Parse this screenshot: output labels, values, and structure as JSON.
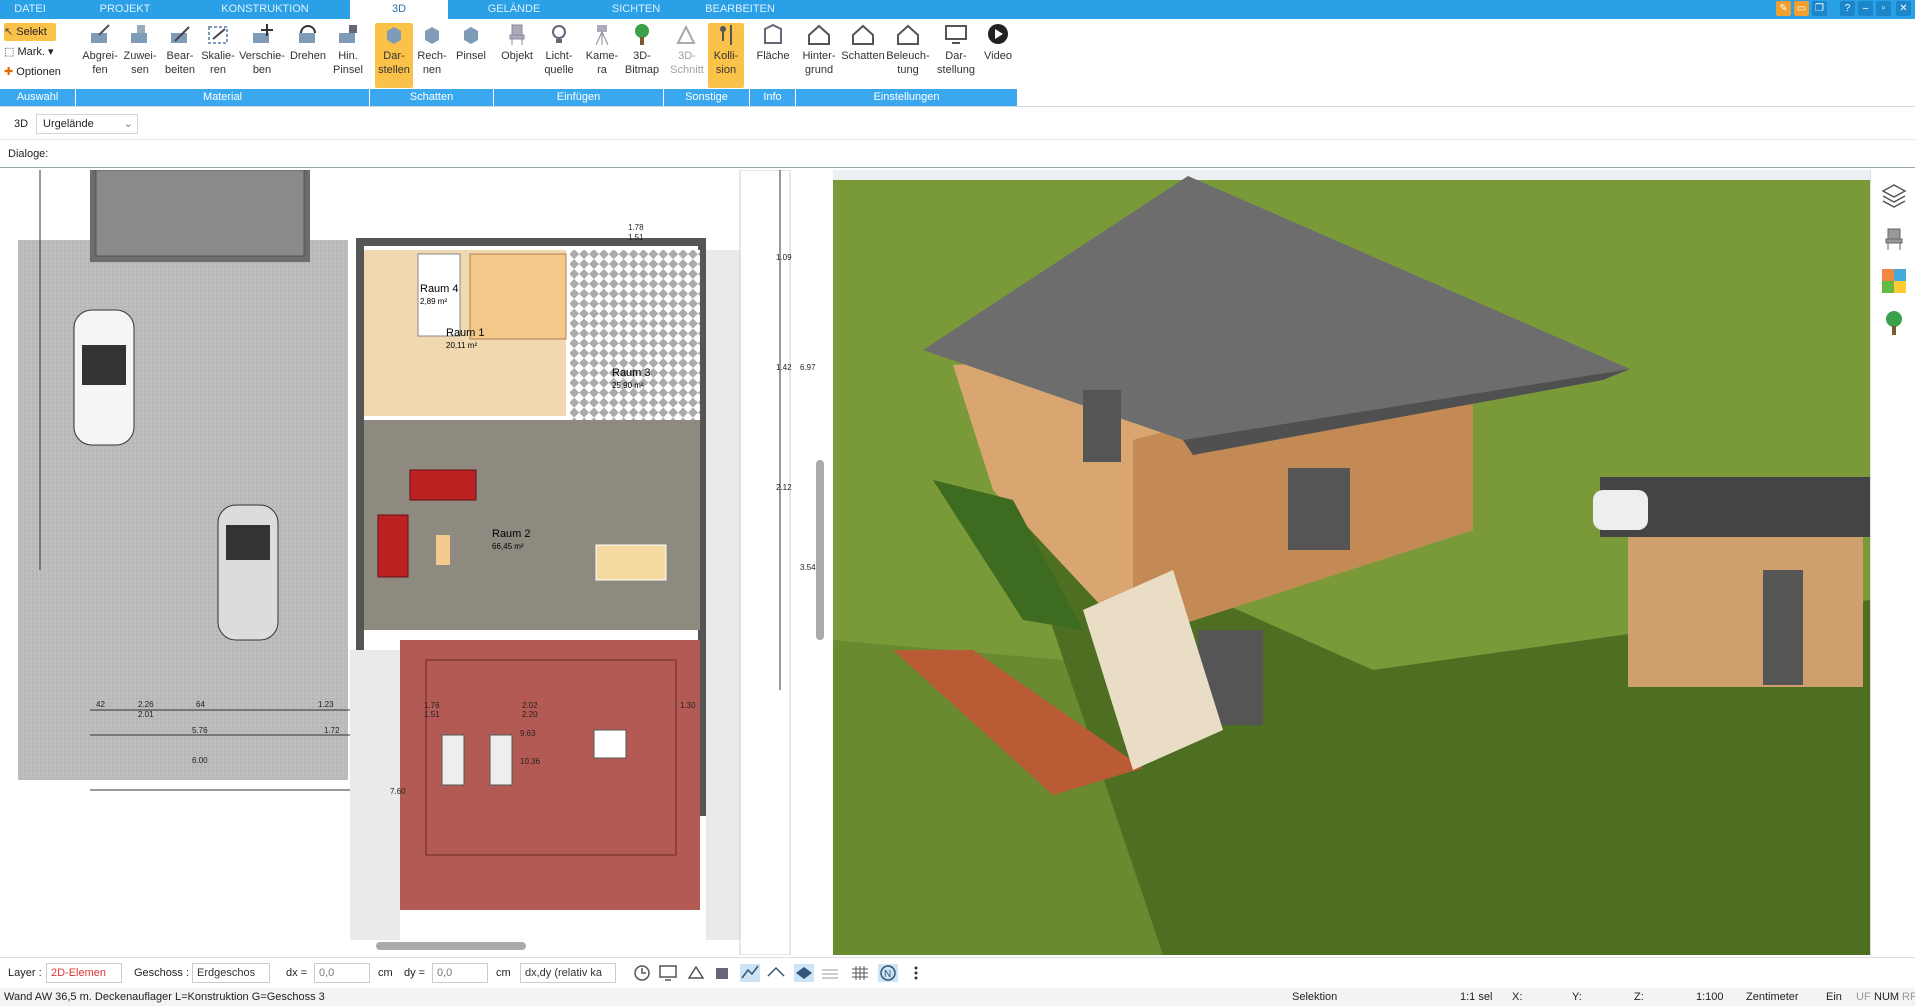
{
  "tabs": [
    "DATEI",
    "PROJEKT",
    "KONSTRUKTION",
    "3D",
    "GELÄNDE",
    "SICHTEN",
    "BEARBEITEN"
  ],
  "ribbon": {
    "small": [
      "Selekt",
      "Mark.",
      "Optionen"
    ],
    "buttons": [
      {
        "l1": "Abgrei-",
        "l2": "fen"
      },
      {
        "l1": "Zuwei-",
        "l2": "sen"
      },
      {
        "l1": "Bear-",
        "l2": "beiten"
      },
      {
        "l1": "Skalie-",
        "l2": "ren"
      },
      {
        "l1": "Verschie-",
        "l2": "ben"
      },
      {
        "l1": "Drehen",
        "l2": ""
      },
      {
        "l1": "Hin.",
        "l2": "Pinsel"
      },
      {
        "l1": "Dar-",
        "l2": "stellen"
      },
      {
        "l1": "Rech-",
        "l2": "nen"
      },
      {
        "l1": "Pinsel",
        "l2": ""
      },
      {
        "l1": "Objekt",
        "l2": ""
      },
      {
        "l1": "Licht-",
        "l2": "quelle"
      },
      {
        "l1": "Kame-",
        "l2": "ra"
      },
      {
        "l1": "3D-",
        "l2": "Bitmap"
      },
      {
        "l1": "3D-",
        "l2": "Schnitt"
      },
      {
        "l1": "Kolli-",
        "l2": "sion"
      },
      {
        "l1": "Fläche",
        "l2": ""
      },
      {
        "l1": "Hinter-",
        "l2": "grund"
      },
      {
        "l1": "Schatten",
        "l2": ""
      },
      {
        "l1": "Beleuch-",
        "l2": "tung"
      },
      {
        "l1": "Dar-",
        "l2": "stellung"
      },
      {
        "l1": "Video",
        "l2": ""
      }
    ],
    "groups": [
      "Auswahl",
      "Material",
      "Schatten",
      "Einfügen",
      "Sonstige",
      "Info",
      "Einstellungen"
    ]
  },
  "view_bar": {
    "mode": "3D",
    "terrain": "Urgelände"
  },
  "dialoge": "Dialoge:",
  "plan": {
    "rooms": [
      {
        "name": "Raum 4",
        "area": "2,89 m²"
      },
      {
        "name": "Raum 1",
        "area": "20,11 m²"
      },
      {
        "name": "Raum 3",
        "area": "25,90 m²"
      },
      {
        "name": "Raum 2",
        "area": "66,45 m²"
      }
    ],
    "dims": [
      "2.26",
      "2.01",
      "64",
      "1.23",
      "42",
      "5.76",
      "1.72",
      "6.00",
      "1.76",
      "1.51",
      "2.02",
      "2.20",
      "1.30",
      "9.63",
      "10.36",
      "7.60",
      "1.78",
      "1.51",
      "6.97",
      "3.54",
      "2.12",
      "1.09",
      "1.42"
    ]
  },
  "bottom": {
    "layer_label": "Layer :",
    "layer_value": "2D-Elemen",
    "geschoss_label": "Geschoss :",
    "geschoss_value": "Erdgeschos",
    "dx_label": "dx =",
    "dx_value": "0,0",
    "dx_unit": "cm",
    "dy_label": "dy =",
    "dy_value": "0,0",
    "dy_unit": "cm",
    "relative": "dx,dy (relativ ka"
  },
  "status": {
    "left": "Wand AW 36,5 m. Deckenauflager L=Konstruktion G=Geschoss 3",
    "mode": "Selektion",
    "sel": "1:1 sel",
    "x": "X:",
    "y": "Y:",
    "z": "Z:",
    "scale": "1:100",
    "unit": "Zentimeter",
    "ein": "Ein",
    "uf": "UF",
    "num": "NUM",
    "rf": "RF"
  }
}
